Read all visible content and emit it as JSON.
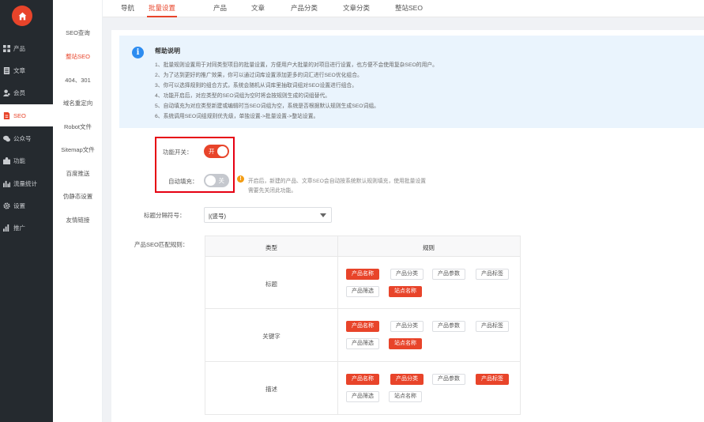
{
  "sidebar": {
    "items": [
      {
        "label": "产品",
        "icon": "grid-icon"
      },
      {
        "label": "文章",
        "icon": "document-icon"
      },
      {
        "label": "会员",
        "icon": "user-icon"
      },
      {
        "label": "SEO",
        "icon": "seo-icon",
        "active": true
      },
      {
        "label": "公众号",
        "icon": "wechat-icon"
      },
      {
        "label": "功能",
        "icon": "puzzle-icon"
      },
      {
        "label": "流量统计",
        "icon": "bar-chart-icon"
      },
      {
        "label": "设置",
        "icon": "gear-icon"
      },
      {
        "label": "推广",
        "icon": "promote-icon"
      }
    ]
  },
  "subnav": {
    "items": [
      {
        "label": "SEO查询"
      },
      {
        "label": "整站SEO",
        "active": true
      },
      {
        "label": "404、301"
      },
      {
        "label": "域名重定向"
      },
      {
        "label": "Robot文件"
      },
      {
        "label": "Sitemap文件"
      },
      {
        "label": "百度推送"
      },
      {
        "label": "伪静态设置"
      },
      {
        "label": "友情链接"
      }
    ]
  },
  "tabs": [
    {
      "label": "导航"
    },
    {
      "label": "批量设置",
      "active": true
    },
    {
      "label": "产品"
    },
    {
      "label": "文章"
    },
    {
      "label": "产品分类"
    },
    {
      "label": "文章分类"
    },
    {
      "label": "整站SEO"
    }
  ],
  "help": {
    "title": "帮助说明",
    "lines": [
      "1、批量规则设置用于对同类型项目的批量设置，方便用户大批量的对项目进行设置，也方便不会使用复杂SEO的用户。",
      "2、为了达到更好的推广效果，你可以通过词库设置添加更多的词汇进行SEO优化组合。",
      "3、你可以选择规则的组合方式，系统会随机从词库里抽取词组对SEO设置进行组合。",
      "4、功能开启后，对应类型的SEO词组为空时将会按规则生成的词组替代。",
      "5、自动填充为对应类型新建或编辑时当SEO词组为空，系统是否根据默认规则生成SEO词组。",
      "6、系统调用SEO词组规则优先级，单独设置->批量设置->整站设置。"
    ]
  },
  "form": {
    "feature_switch": {
      "label": "功能开关：",
      "state_text": "开",
      "on": true
    },
    "auto_fill": {
      "label": "自动填充：",
      "state_text": "关",
      "on": false
    },
    "tip_lines": [
      "开启后，新建的产品、文章SEO会自动按系统默认规则填充，使用批量设置",
      "需要先关闭此功能。"
    ],
    "separator": {
      "label": "标题分隔符号：",
      "value": "|(竖号)"
    },
    "rule_label": "产品SEO匹配规则："
  },
  "rule_table": {
    "headers": [
      "类型",
      "规则"
    ],
    "rows": [
      {
        "type": "标题",
        "tags": [
          {
            "label": "产品名称",
            "on": true
          },
          {
            "label": "产品分类",
            "on": false
          },
          {
            "label": "产品参数",
            "on": false
          },
          {
            "label": "产品标签",
            "on": false
          },
          {
            "label": "产品筛选",
            "on": false
          },
          {
            "label": "站点名称",
            "on": true
          }
        ]
      },
      {
        "type": "关键字",
        "tags": [
          {
            "label": "产品名称",
            "on": true
          },
          {
            "label": "产品分类",
            "on": false
          },
          {
            "label": "产品参数",
            "on": false
          },
          {
            "label": "产品标签",
            "on": false
          },
          {
            "label": "产品筛选",
            "on": false
          },
          {
            "label": "站点名称",
            "on": true
          }
        ]
      },
      {
        "type": "描述",
        "tags": [
          {
            "label": "产品名称",
            "on": true
          },
          {
            "label": "产品分类",
            "on": true
          },
          {
            "label": "产品参数",
            "on": false
          },
          {
            "label": "产品标签",
            "on": true
          },
          {
            "label": "产品筛选",
            "on": false
          },
          {
            "label": "站点名称",
            "on": false
          }
        ]
      }
    ]
  },
  "colors": {
    "accent": "#e8442a",
    "sidebar_bg": "#252a2f",
    "help_bg": "#eaf4fd",
    "highlight_border": "#e60012"
  }
}
